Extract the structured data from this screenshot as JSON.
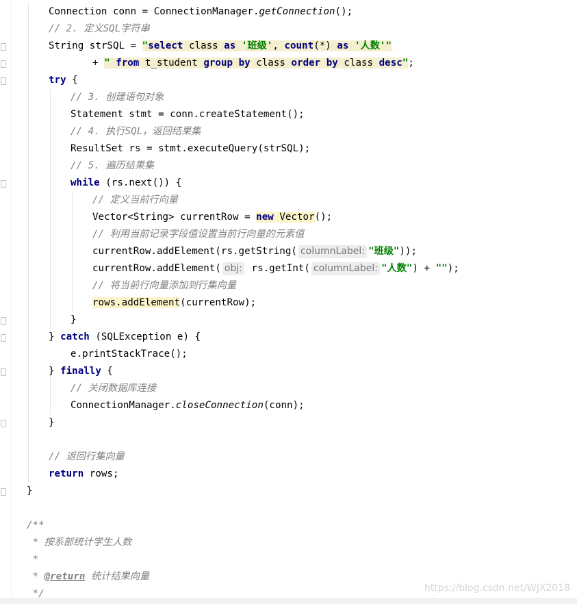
{
  "editor": {
    "watermark": "https://blog.csdn.net/WJX2018",
    "lines": [
      {
        "indent": 2,
        "tokens": [
          {
            "t": "Connection conn = ConnectionManager."
          },
          {
            "t": "getConnection",
            "c": "it"
          },
          {
            "t": "();"
          }
        ]
      },
      {
        "indent": 2,
        "tokens": [
          {
            "t": "// 2. 定义SQL字符串",
            "c": "cm"
          }
        ]
      },
      {
        "indent": 2,
        "tokens": [
          {
            "t": "String strSQL = "
          },
          {
            "t": "\"",
            "c": "str inj"
          },
          {
            "t": "select",
            "c": "kw inj"
          },
          {
            "t": " class ",
            "c": "inj"
          },
          {
            "t": "as",
            "c": "kw inj"
          },
          {
            "t": " ",
            "c": "inj"
          },
          {
            "t": "'班级'",
            "c": "str inj"
          },
          {
            "t": ", ",
            "c": "inj"
          },
          {
            "t": "count",
            "c": "kw inj"
          },
          {
            "t": "(*) ",
            "c": "inj"
          },
          {
            "t": "as",
            "c": "kw inj"
          },
          {
            "t": " ",
            "c": "inj"
          },
          {
            "t": "'人数'",
            "c": "str inj"
          },
          {
            "t": "\"",
            "c": "str inj"
          }
        ]
      },
      {
        "indent": 4,
        "tokens": [
          {
            "t": "+ "
          },
          {
            "t": "\" ",
            "c": "str inj"
          },
          {
            "t": "from",
            "c": "kw inj"
          },
          {
            "t": " t_student ",
            "c": "inj"
          },
          {
            "t": "group",
            "c": "kw inj"
          },
          {
            "t": " ",
            "c": "inj"
          },
          {
            "t": "by",
            "c": "kw inj"
          },
          {
            "t": " class ",
            "c": "inj"
          },
          {
            "t": "order",
            "c": "kw inj"
          },
          {
            "t": " ",
            "c": "inj"
          },
          {
            "t": "by",
            "c": "kw inj"
          },
          {
            "t": " class ",
            "c": "inj"
          },
          {
            "t": "desc",
            "c": "kw inj"
          },
          {
            "t": "\"",
            "c": "str inj"
          },
          {
            "t": ";"
          }
        ]
      },
      {
        "indent": 2,
        "tokens": [
          {
            "t": "try",
            "c": "kw"
          },
          {
            "t": " {"
          }
        ]
      },
      {
        "indent": 3,
        "tokens": [
          {
            "t": "// 3. 创建语句对象",
            "c": "cm"
          }
        ]
      },
      {
        "indent": 3,
        "tokens": [
          {
            "t": "Statement stmt = conn.createStatement();"
          }
        ]
      },
      {
        "indent": 3,
        "tokens": [
          {
            "t": "// 4. 执行SQL，返回结果集",
            "c": "cm"
          }
        ]
      },
      {
        "indent": 3,
        "tokens": [
          {
            "t": "ResultSet rs = stmt.executeQuery(strSQL);"
          }
        ]
      },
      {
        "indent": 3,
        "tokens": [
          {
            "t": "// 5. 遍历结果集",
            "c": "cm"
          }
        ]
      },
      {
        "indent": 3,
        "tokens": [
          {
            "t": "while",
            "c": "kw"
          },
          {
            "t": " (rs.next()) {"
          }
        ]
      },
      {
        "indent": 4,
        "tokens": [
          {
            "t": "// 定义当前行向量",
            "c": "cm"
          }
        ]
      },
      {
        "indent": 4,
        "tokens": [
          {
            "t": "Vector<String> currentRow = "
          },
          {
            "t": "new",
            "c": "kw hl"
          },
          {
            "t": " Vector",
            "c": "hl"
          },
          {
            "t": "();"
          }
        ]
      },
      {
        "indent": 4,
        "tokens": [
          {
            "t": "// 利用当前记录字段值设置当前行向量的元素值",
            "c": "cm"
          }
        ]
      },
      {
        "indent": 4,
        "tokens": [
          {
            "t": "currentRow.addElement(rs.getString("
          },
          {
            "t": "columnLabel:",
            "c": "hint"
          },
          {
            "t": "\"班级\"",
            "c": "str"
          },
          {
            "t": "));"
          }
        ]
      },
      {
        "indent": 4,
        "tokens": [
          {
            "t": "currentRow.addElement("
          },
          {
            "t": "obj:",
            "c": "hint"
          },
          {
            "t": " rs.getInt("
          },
          {
            "t": "columnLabel:",
            "c": "hint"
          },
          {
            "t": "\"人数\"",
            "c": "str"
          },
          {
            "t": ") + "
          },
          {
            "t": "\"\"",
            "c": "str"
          },
          {
            "t": ");"
          }
        ]
      },
      {
        "indent": 4,
        "tokens": [
          {
            "t": "// 将当前行向量添加到行集向量",
            "c": "cm"
          }
        ]
      },
      {
        "indent": 4,
        "tokens": [
          {
            "t": "rows.addElement",
            "c": "hl"
          },
          {
            "t": "(currentRow);"
          }
        ]
      },
      {
        "indent": 3,
        "tokens": [
          {
            "t": "}"
          }
        ]
      },
      {
        "indent": 2,
        "tokens": [
          {
            "t": "} "
          },
          {
            "t": "catch",
            "c": "kw"
          },
          {
            "t": " (SQLException e) {"
          }
        ]
      },
      {
        "indent": 3,
        "tokens": [
          {
            "t": "e.printStackTrace();"
          }
        ]
      },
      {
        "indent": 2,
        "tokens": [
          {
            "t": "} "
          },
          {
            "t": "finally",
            "c": "kw"
          },
          {
            "t": " {"
          }
        ]
      },
      {
        "indent": 3,
        "tokens": [
          {
            "t": "// 关闭数据库连接",
            "c": "cm"
          }
        ]
      },
      {
        "indent": 3,
        "tokens": [
          {
            "t": "ConnectionManager."
          },
          {
            "t": "closeConnection",
            "c": "it"
          },
          {
            "t": "(conn);"
          }
        ]
      },
      {
        "indent": 2,
        "tokens": [
          {
            "t": "}"
          }
        ]
      },
      {
        "indent": 2,
        "tokens": []
      },
      {
        "indent": 2,
        "tokens": [
          {
            "t": "// 返回行集向量",
            "c": "cm"
          }
        ]
      },
      {
        "indent": 2,
        "tokens": [
          {
            "t": "return",
            "c": "kw"
          },
          {
            "t": " rows;"
          }
        ]
      },
      {
        "indent": 1,
        "tokens": [
          {
            "t": "}"
          }
        ]
      },
      {
        "indent": 1,
        "tokens": []
      },
      {
        "indent": 1,
        "tokens": [
          {
            "t": "/**",
            "c": "cm"
          }
        ]
      },
      {
        "indent": 1,
        "tokens": [
          {
            "t": " * 按系部统计学生人数",
            "c": "cm"
          }
        ]
      },
      {
        "indent": 1,
        "tokens": [
          {
            "t": " *",
            "c": "cm"
          }
        ]
      },
      {
        "indent": 1,
        "tokens": [
          {
            "t": " * ",
            "c": "cm"
          },
          {
            "t": "@return",
            "c": "cm tag"
          },
          {
            "t": " 统计结果向量",
            "c": "cm"
          }
        ]
      },
      {
        "indent": 1,
        "tokens": [
          {
            "t": " */",
            "c": "cm"
          }
        ]
      }
    ]
  }
}
